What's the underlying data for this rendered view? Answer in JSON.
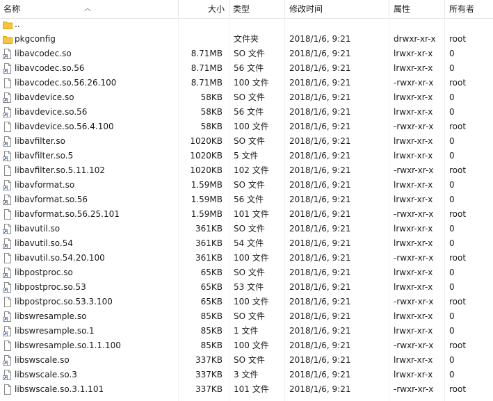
{
  "columns": {
    "name": "名称",
    "size": "大小",
    "type": "类型",
    "modified": "修改时间",
    "attributes": "属性",
    "owner": "所有者"
  },
  "sort": {
    "column": "name",
    "direction": "ascending"
  },
  "colors": {
    "folder": "#f5c542",
    "folder_dark": "#e0a800",
    "file_outline": "#8a8a8a",
    "accent": "#2b5fb5"
  },
  "files": [
    {
      "icon": "folder-icon",
      "name": "..",
      "size": "",
      "type": "",
      "modified": "",
      "attributes": "",
      "owner": ""
    },
    {
      "icon": "folder-icon",
      "name": "pkgconfig",
      "size": "",
      "type": "文件夹",
      "modified": "2018/1/6, 9:21",
      "attributes": "drwxr-xr-x",
      "owner": "root"
    },
    {
      "icon": "shortcut-file-icon",
      "name": "libavcodec.so",
      "size": "8.71MB",
      "type": "SO 文件",
      "modified": "2018/1/6, 9:21",
      "attributes": "lrwxr-xr-x",
      "owner": "0"
    },
    {
      "icon": "shortcut-file-icon",
      "name": "libavcodec.so.56",
      "size": "8.71MB",
      "type": "56 文件",
      "modified": "2018/1/6, 9:21",
      "attributes": "lrwxr-xr-x",
      "owner": "0"
    },
    {
      "icon": "file-icon",
      "name": "libavcodec.so.56.26.100",
      "size": "8.71MB",
      "type": "100 文件",
      "modified": "2018/1/6, 9:21",
      "attributes": "-rwxr-xr-x",
      "owner": "root"
    },
    {
      "icon": "shortcut-file-icon",
      "name": "libavdevice.so",
      "size": "58KB",
      "type": "SO 文件",
      "modified": "2018/1/6, 9:21",
      "attributes": "lrwxr-xr-x",
      "owner": "0"
    },
    {
      "icon": "shortcut-file-icon",
      "name": "libavdevice.so.56",
      "size": "58KB",
      "type": "56 文件",
      "modified": "2018/1/6, 9:21",
      "attributes": "lrwxr-xr-x",
      "owner": "0"
    },
    {
      "icon": "file-icon",
      "name": "libavdevice.so.56.4.100",
      "size": "58KB",
      "type": "100 文件",
      "modified": "2018/1/6, 9:21",
      "attributes": "-rwxr-xr-x",
      "owner": "root"
    },
    {
      "icon": "shortcut-file-icon",
      "name": "libavfilter.so",
      "size": "1020KB",
      "type": "SO 文件",
      "modified": "2018/1/6, 9:21",
      "attributes": "lrwxr-xr-x",
      "owner": "0"
    },
    {
      "icon": "shortcut-file-icon",
      "name": "libavfilter.so.5",
      "size": "1020KB",
      "type": "5 文件",
      "modified": "2018/1/6, 9:21",
      "attributes": "lrwxr-xr-x",
      "owner": "0"
    },
    {
      "icon": "file-icon",
      "name": "libavfilter.so.5.11.102",
      "size": "1020KB",
      "type": "102 文件",
      "modified": "2018/1/6, 9:21",
      "attributes": "-rwxr-xr-x",
      "owner": "root"
    },
    {
      "icon": "shortcut-file-icon",
      "name": "libavformat.so",
      "size": "1.59MB",
      "type": "SO 文件",
      "modified": "2018/1/6, 9:21",
      "attributes": "lrwxr-xr-x",
      "owner": "0"
    },
    {
      "icon": "shortcut-file-icon",
      "name": "libavformat.so.56",
      "size": "1.59MB",
      "type": "56 文件",
      "modified": "2018/1/6, 9:21",
      "attributes": "lrwxr-xr-x",
      "owner": "0"
    },
    {
      "icon": "file-icon",
      "name": "libavformat.so.56.25.101",
      "size": "1.59MB",
      "type": "101 文件",
      "modified": "2018/1/6, 9:21",
      "attributes": "-rwxr-xr-x",
      "owner": "root"
    },
    {
      "icon": "shortcut-file-icon",
      "name": "libavutil.so",
      "size": "361KB",
      "type": "SO 文件",
      "modified": "2018/1/6, 9:21",
      "attributes": "lrwxr-xr-x",
      "owner": "0"
    },
    {
      "icon": "shortcut-file-icon",
      "name": "libavutil.so.54",
      "size": "361KB",
      "type": "54 文件",
      "modified": "2018/1/6, 9:21",
      "attributes": "lrwxr-xr-x",
      "owner": "0"
    },
    {
      "icon": "file-icon",
      "name": "libavutil.so.54.20.100",
      "size": "361KB",
      "type": "100 文件",
      "modified": "2018/1/6, 9:21",
      "attributes": "-rwxr-xr-x",
      "owner": "root"
    },
    {
      "icon": "shortcut-file-icon",
      "name": "libpostproc.so",
      "size": "65KB",
      "type": "SO 文件",
      "modified": "2018/1/6, 9:21",
      "attributes": "lrwxr-xr-x",
      "owner": "0"
    },
    {
      "icon": "shortcut-file-icon",
      "name": "libpostproc.so.53",
      "size": "65KB",
      "type": "53 文件",
      "modified": "2018/1/6, 9:21",
      "attributes": "lrwxr-xr-x",
      "owner": "0"
    },
    {
      "icon": "file-icon",
      "name": "libpostproc.so.53.3.100",
      "size": "65KB",
      "type": "100 文件",
      "modified": "2018/1/6, 9:21",
      "attributes": "-rwxr-xr-x",
      "owner": "root"
    },
    {
      "icon": "shortcut-file-icon",
      "name": "libswresample.so",
      "size": "85KB",
      "type": "SO 文件",
      "modified": "2018/1/6, 9:21",
      "attributes": "lrwxr-xr-x",
      "owner": "0"
    },
    {
      "icon": "shortcut-file-icon",
      "name": "libswresample.so.1",
      "size": "85KB",
      "type": "1 文件",
      "modified": "2018/1/6, 9:21",
      "attributes": "lrwxr-xr-x",
      "owner": "0"
    },
    {
      "icon": "file-icon",
      "name": "libswresample.so.1.1.100",
      "size": "85KB",
      "type": "100 文件",
      "modified": "2018/1/6, 9:21",
      "attributes": "-rwxr-xr-x",
      "owner": "root"
    },
    {
      "icon": "shortcut-file-icon",
      "name": "libswscale.so",
      "size": "337KB",
      "type": "SO 文件",
      "modified": "2018/1/6, 9:21",
      "attributes": "lrwxr-xr-x",
      "owner": "0"
    },
    {
      "icon": "shortcut-file-icon",
      "name": "libswscale.so.3",
      "size": "337KB",
      "type": "3 文件",
      "modified": "2018/1/6, 9:21",
      "attributes": "lrwxr-xr-x",
      "owner": "0"
    },
    {
      "icon": "file-icon",
      "name": "libswscale.so.3.1.101",
      "size": "337KB",
      "type": "101 文件",
      "modified": "2018/1/6, 9:21",
      "attributes": "-rwxr-xr-x",
      "owner": "root"
    }
  ]
}
